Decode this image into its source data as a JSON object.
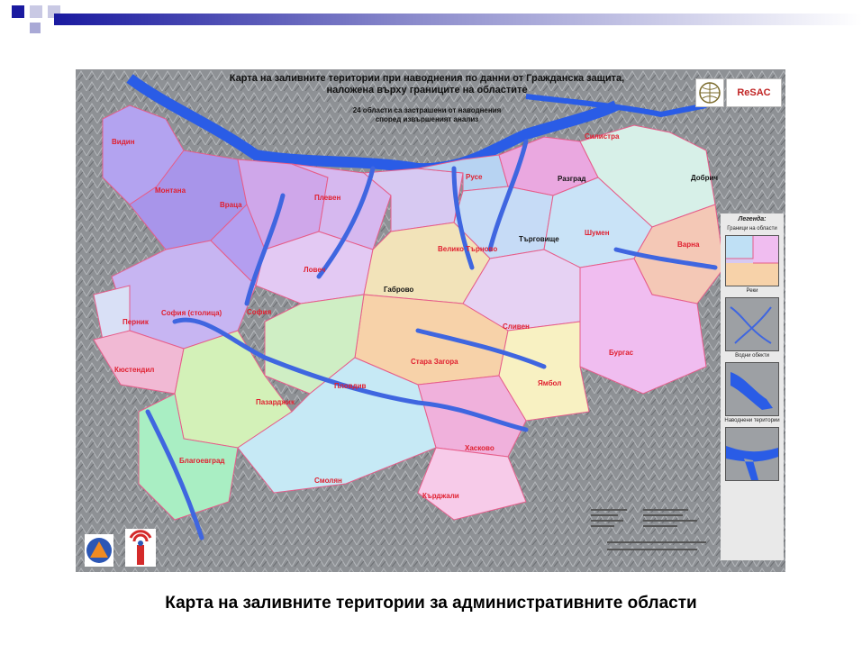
{
  "colors": {
    "accent": "#1a1aa0",
    "water": "#2a5ce6",
    "river": "#3f66e0"
  },
  "map": {
    "title_line1": "Карта на заливните територии при наводнения по данни от Гражданска защита,",
    "title_line2": "наложена върху границите на областите",
    "subtitle_line1": "24 области са застрашени от наводнения",
    "subtitle_line2": "според извършеният анализ",
    "logo_text": "ReSAC",
    "regions": [
      {
        "name": "Видин",
        "color": "red"
      },
      {
        "name": "Монтана",
        "color": "red"
      },
      {
        "name": "Враца",
        "color": "red"
      },
      {
        "name": "Плевен",
        "color": "red"
      },
      {
        "name": "Русе",
        "color": "red"
      },
      {
        "name": "Силистра",
        "color": "red"
      },
      {
        "name": "Разград",
        "color": "dark"
      },
      {
        "name": "Добрич",
        "color": "dark"
      },
      {
        "name": "Велико Търново",
        "color": "red"
      },
      {
        "name": "Търговище",
        "color": "dark"
      },
      {
        "name": "Шумен",
        "color": "red"
      },
      {
        "name": "Варна",
        "color": "red"
      },
      {
        "name": "Ловеч",
        "color": "red"
      },
      {
        "name": "Габрово",
        "color": "dark"
      },
      {
        "name": "София (столица)",
        "color": "red"
      },
      {
        "name": "София",
        "color": "red"
      },
      {
        "name": "Перник",
        "color": "red"
      },
      {
        "name": "Сливен",
        "color": "red"
      },
      {
        "name": "Бургас",
        "color": "red"
      },
      {
        "name": "Кюстендил",
        "color": "red"
      },
      {
        "name": "Стара Загора",
        "color": "red"
      },
      {
        "name": "Пловдив",
        "color": "red"
      },
      {
        "name": "Ямбол",
        "color": "red"
      },
      {
        "name": "Пазарджик",
        "color": "red"
      },
      {
        "name": "Хасково",
        "color": "red"
      },
      {
        "name": "Благоевград",
        "color": "red"
      },
      {
        "name": "Смолян",
        "color": "red"
      },
      {
        "name": "Кърджали",
        "color": "red"
      }
    ],
    "legend": {
      "title": "Легенда:",
      "items": [
        {
          "label": "Граници на области"
        },
        {
          "label": "Реки"
        },
        {
          "label": "Водни обекти"
        },
        {
          "label": "Наводнени територии"
        }
      ]
    }
  },
  "caption": "Карта на заливните територии за административните области"
}
